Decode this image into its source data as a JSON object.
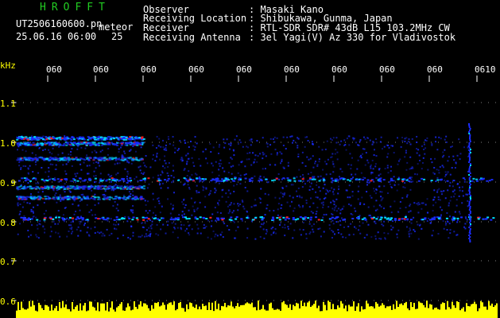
{
  "header": {
    "logo": "HROFFT",
    "filename": "UT2506160600.pn",
    "meteor_label": "meteor",
    "datetime": "25.06.16 06:00",
    "count": "25",
    "fields": [
      {
        "label": "Observer",
        "value": ": Masaki Kano"
      },
      {
        "label": "Receiving Location",
        "value": ": Shibukawa, Gunma, Japan"
      },
      {
        "label": "Receiver",
        "value": ": RTL-SDR SDR# 43dB L15 103.2MHz CW"
      },
      {
        "label": "Receiving Antenna",
        "value": ": 3el Yagi(V) Az 330 for Vladivostok"
      }
    ]
  },
  "spectrogram": {
    "freq_unit": "kHz",
    "freq_ticks": [
      "1.1",
      "1.0",
      "0.9",
      "0.8",
      "0.7",
      "0.6"
    ],
    "time_ticks": [
      "060",
      "060",
      "060",
      "060",
      "060",
      "060",
      "060",
      "060",
      "060",
      "0610"
    ],
    "colors": {
      "background": "#000000",
      "noise": "#1a2cff",
      "signal": "#00e0ff",
      "peak": "#ff2020",
      "level": "#ffff00"
    }
  }
}
